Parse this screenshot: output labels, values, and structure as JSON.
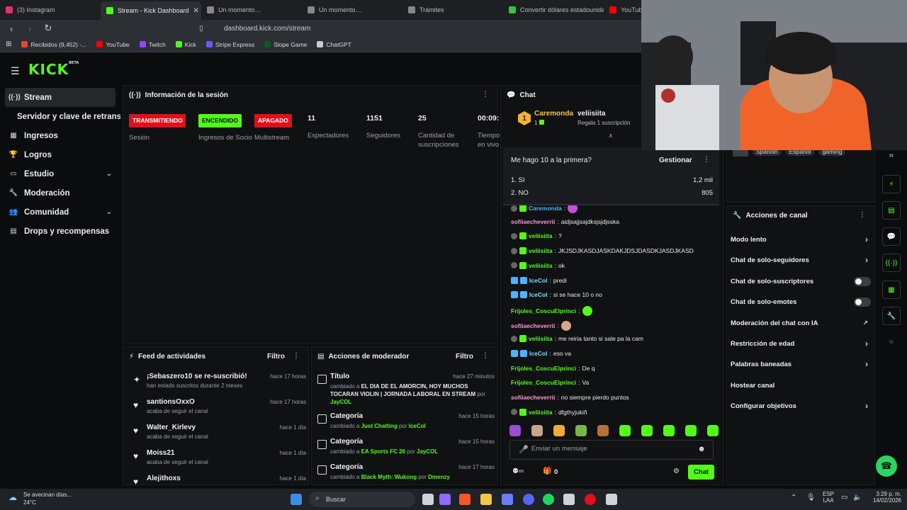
{
  "browser": {
    "tabs": [
      {
        "title": "(3) Instagram",
        "color": "#e1306c"
      },
      {
        "title": "Stream - Kick Dashboard",
        "color": "#53fc18",
        "active": true
      },
      {
        "title": "Un momento…",
        "color": "#888888"
      },
      {
        "title": "Un momento…",
        "color": "#888888"
      },
      {
        "title": "Trámites",
        "color": "#888888"
      },
      {
        "title": "Convertir dólares estadounide",
        "color": "#32c83a"
      },
      {
        "title": "YouTub",
        "color": "#ff0000"
      }
    ],
    "url": "dashboard.kick.com/stream",
    "bookmarks": [
      {
        "label": "Recibidos (9,452) -...",
        "color": "#ea4335"
      },
      {
        "label": "YouTube",
        "color": "#ff0000"
      },
      {
        "label": "Twitch",
        "color": "#9146ff"
      },
      {
        "label": "Kick",
        "color": "#53fc18"
      },
      {
        "label": "Stripe Express",
        "color": "#635bff"
      },
      {
        "label": "Slope Game",
        "color": "#0f5a1e"
      },
      {
        "label": "ChatGPT",
        "color": "#cccccc"
      }
    ]
  },
  "header": {
    "logo": "KICK",
    "logo_sup": "BETA"
  },
  "sidebar": {
    "items": [
      {
        "label": "Stream",
        "icon": "broadcast-icon",
        "glyph": "((·))"
      },
      {
        "label": "Servidor y clave de retransmisión"
      },
      {
        "label": "Ingresos",
        "icon": "money-icon",
        "glyph": "▦"
      },
      {
        "label": "Logros",
        "icon": "trophy-icon",
        "glyph": "🏆"
      },
      {
        "label": "Estudio",
        "icon": "studio-icon",
        "glyph": "▭"
      },
      {
        "label": "Moderación",
        "icon": "wrench-icon",
        "glyph": "🔧"
      },
      {
        "label": "Comunidad",
        "icon": "community-icon",
        "glyph": "👥"
      },
      {
        "label": "Drops y recompensas",
        "icon": "drops-icon",
        "glyph": "▤"
      }
    ]
  },
  "session": {
    "title": "Información de la sesión",
    "columns": [
      {
        "badge": "TRANSMITIENDO",
        "label": "Sesión",
        "style": "red"
      },
      {
        "badge": "ENCENDIDO",
        "label": "Ingresos de Socio",
        "style": "green"
      },
      {
        "badge": "APAGADO",
        "label": "Multistream",
        "style": "red"
      },
      {
        "value": "11",
        "label": "Espectadores"
      },
      {
        "value": "1151",
        "label": "Seguidores"
      },
      {
        "value": "25",
        "label": "Cantidad de suscripciones"
      },
      {
        "value": "00:09:",
        "label": "Tiempo en vivo"
      }
    ]
  },
  "feed": {
    "title": "Feed de actividades",
    "filter": "Filtro",
    "items": [
      {
        "icon": "sparkle-icon",
        "glyph": "✦",
        "title": "¡Sebaszero10 se re-suscribió!",
        "sub": "han estado suscritos durante 2 meses",
        "time": "hace 17 horas"
      },
      {
        "icon": "heart-icon",
        "glyph": "♥",
        "title": "santionsOxxO",
        "sub": "acaba de seguir el canal",
        "time": "hace 17 horas"
      },
      {
        "icon": "heart-icon",
        "glyph": "♥",
        "title": "Walter_Kirlevy",
        "sub": "acaba de seguir el canal",
        "time": "hace 1 día"
      },
      {
        "icon": "heart-icon",
        "glyph": "♥",
        "title": "Moiss21",
        "sub": "acaba de seguir el canal",
        "time": "hace 1 día"
      },
      {
        "icon": "heart-icon",
        "glyph": "♥",
        "title": "Alejithoxs",
        "sub": "",
        "time": "hace 1 día"
      }
    ]
  },
  "mod": {
    "title": "Acciones de moderador",
    "filter": "Filtro",
    "items": [
      {
        "title": "Título",
        "time": "hace 27 minutos",
        "pre": "cambiado a ",
        "value": "EL DIA DE EL AMORCIN, HOY MUCHOS TOCARAN VIOLIN | JORNADA LABORAL EN STREAM",
        "by": "JayCOL"
      },
      {
        "title": "Categoría",
        "time": "hace 15 horas",
        "pre": "cambiado a ",
        "value": "Just Chatting",
        "by": "IceCol"
      },
      {
        "title": "Categoría",
        "time": "hace 15 horas",
        "pre": "cambiado a ",
        "value": "EA Sports FC 26",
        "by": "JayCOL"
      },
      {
        "title": "Categoría",
        "time": "hace 17 horas",
        "pre": "cambiado a ",
        "value": "Black Myth: Wukong",
        "by": "Dmenzy"
      }
    ],
    "por": "por"
  },
  "chat": {
    "title": "Chat",
    "pinned": {
      "rank": "1",
      "user": "Caremonda",
      "count": "1",
      "gifter": "veliisiita",
      "gift_text": "Regala 1 suscripción"
    },
    "poll": {
      "question": "Me hago 10 a la primera?",
      "manage": "Gestionar",
      "options": [
        {
          "label": "1. SI",
          "votes": "1,2 mil"
        },
        {
          "label": "2. NO",
          "votes": "805"
        }
      ]
    },
    "messages": [
      {
        "user": "Caremonda",
        "color": "u-blue",
        "text": "",
        "badges": [
          "m-gray",
          "m-shield"
        ],
        "emoji": "#c64fe0"
      },
      {
        "user": "sofiiaecheverrii",
        "color": "u-pink",
        "text": "aidjsajjsajdksjsjdjsska",
        "badges": []
      },
      {
        "user": "veliisiita",
        "color": "u-green",
        "text": "?",
        "badges": [
          "m-gray",
          "m-shield"
        ]
      },
      {
        "user": "veliisiita",
        "color": "u-green",
        "text": "JKJSDJKASDJASKDAKJDSJDASDKJASDJKASD",
        "badges": [
          "m-gray",
          "m-shield"
        ]
      },
      {
        "user": "veliisiita",
        "color": "u-green",
        "text": "ok",
        "badges": [
          "m-gray",
          "m-shield"
        ]
      },
      {
        "user": "IceCol",
        "color": "u-cyan",
        "text": "predi",
        "badges": [
          "m-sword",
          "m-sword"
        ]
      },
      {
        "user": "IceCol",
        "color": "u-cyan",
        "text": "si se hace 10 o no",
        "badges": [
          "m-sword",
          "m-sword"
        ]
      },
      {
        "user": "Frijoles_CoscuElprinci",
        "color": "u-green",
        "text": "",
        "badges": [],
        "emoji": "#53fc18"
      },
      {
        "user": "sofiiaecheverrii",
        "color": "u-pink",
        "text": "",
        "badges": [],
        "emoji": "#d9a48a"
      },
      {
        "user": "veliisiita",
        "color": "u-green",
        "text": "me reiria tanto si sale pa la cam",
        "badges": [
          "m-gray",
          "m-shield"
        ]
      },
      {
        "user": "IceCol",
        "color": "u-cyan",
        "text": "eso va",
        "badges": [
          "m-sword",
          "m-sword"
        ]
      },
      {
        "user": "Frijoles_CoscuElprinci",
        "color": "u-green",
        "text": "De q",
        "badges": []
      },
      {
        "user": "Frijoles_CoscuElprinci",
        "color": "u-green",
        "text": "Va",
        "badges": []
      },
      {
        "user": "sofiiaecheverrii",
        "color": "u-pink",
        "text": "no siempre pierdo puntos",
        "badges": []
      },
      {
        "user": "veliisiita",
        "color": "u-green",
        "text": "dfgthyjukiñ",
        "badges": [
          "m-gray",
          "m-shield"
        ]
      }
    ],
    "emotes": [
      "#9b4fd0",
      "#c9a58a",
      "#f2a93b",
      "#7ab648",
      "#b8703a",
      "#53fc18",
      "#53fc18",
      "#53fc18",
      "#53fc18",
      "#53fc18"
    ],
    "placeholder": "Enviar un mensaje",
    "points": "0",
    "send": "Chat"
  },
  "channel": {
    "tags": [
      "Spanish",
      "Español",
      "gaming"
    ],
    "actions_title": "Acciones de canal",
    "actions": [
      {
        "label": "Modo lento",
        "control": "arrow"
      },
      {
        "label": "Chat de solo-seguidores",
        "control": "arrow"
      },
      {
        "label": "Chat de solo-suscriptores",
        "control": "toggle"
      },
      {
        "label": "Chat de solo-emotes",
        "control": "toggle"
      },
      {
        "label": "Moderación del chat con IA",
        "control": "ext"
      },
      {
        "label": "Restricción de edad",
        "control": "arrow"
      },
      {
        "label": "Palabras baneadas",
        "control": "arrow"
      },
      {
        "label": "Hostear canal",
        "control": "none"
      },
      {
        "label": "Configurar objetivos",
        "control": "arrow"
      }
    ]
  },
  "taskbar": {
    "weather_title": "Se avecinan días...",
    "weather_temp": "24°C",
    "search": "Buscar",
    "lang": "ESP",
    "lang2": "LAA",
    "time": "3:29 p. m.",
    "date": "14/02/2026"
  }
}
